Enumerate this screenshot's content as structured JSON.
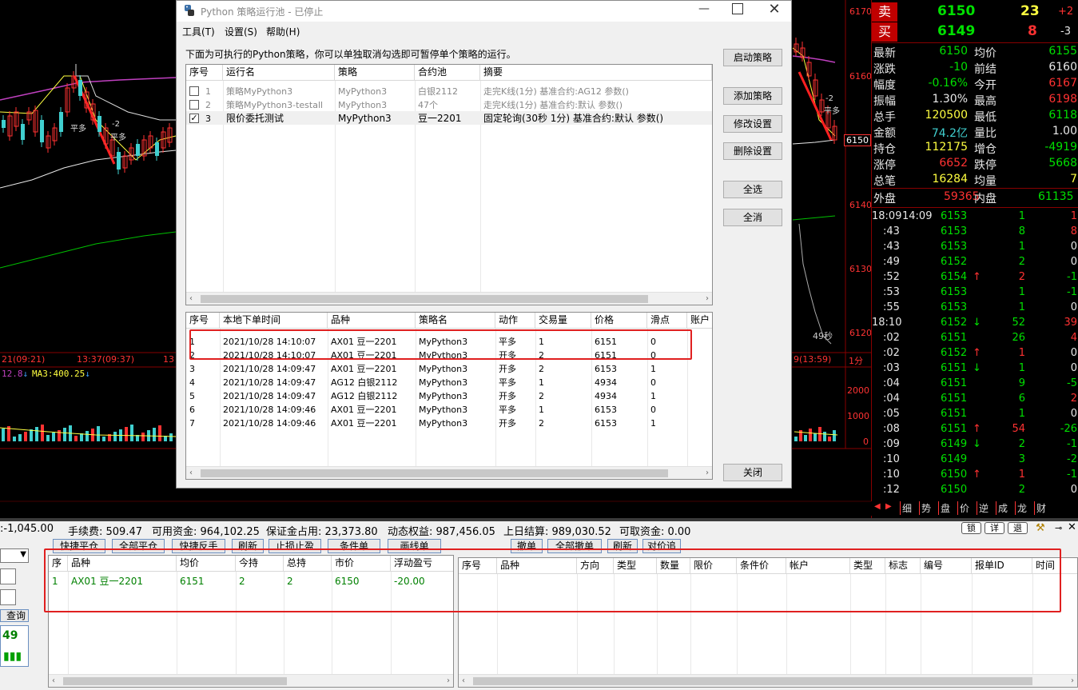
{
  "chart": {
    "price_labels": [
      "6170",
      "6160",
      "6150",
      "6140",
      "6130",
      "6120"
    ],
    "volume_labels": [
      "2000",
      "1000",
      "0"
    ],
    "time_labels": [
      "21(09:21)",
      "13:37(09:37)",
      "13",
      "9(13:59)"
    ],
    "period_label": "1分",
    "ma_line": "MA3:400.25",
    "ma_prefix": "12.8",
    "annotations": [
      "-2",
      "平多",
      "-2",
      "平多",
      "-2",
      "平多"
    ],
    "current_price_tag": "6150",
    "countdown": "49秒"
  },
  "quote": {
    "sell": {
      "label": "卖",
      "price": "6150",
      "vol": "23",
      "chg": "+2"
    },
    "buy": {
      "label": "买",
      "price": "6149",
      "vol": "8",
      "chg": "-3"
    },
    "rows": [
      {
        "l1": "最新",
        "v1": "6150",
        "l2": "均价",
        "v2": "6155"
      },
      {
        "l1": "涨跌",
        "v1": "-10",
        "l2": "前结",
        "v2": "6160"
      },
      {
        "l1": "幅度",
        "v1": "-0.16%",
        "l2": "今开",
        "v2": "6167"
      },
      {
        "l1": "振幅",
        "v1": "1.30%",
        "l2": "最高",
        "v2": "6198"
      },
      {
        "l1": "总手",
        "v1": "120500",
        "l2": "最低",
        "v2": "6118"
      },
      {
        "l1": "金额",
        "v1": "74.2亿",
        "l2": "量比",
        "v2": "1.00"
      },
      {
        "l1": "持仓",
        "v1": "112175",
        "l2": "增仓",
        "v2": "-4919"
      },
      {
        "l1": "涨停",
        "v1": "6652",
        "l2": "跌停",
        "v2": "5668"
      },
      {
        "l1": "总笔",
        "v1": "16284",
        "l2": "均量",
        "v2": "7"
      }
    ],
    "outer": {
      "l": "外盘",
      "v": "59365",
      "l2": "内盘",
      "v2": "61135"
    },
    "ticks": [
      {
        "t": "18:09",
        "t2": "14:09",
        "p": "6153",
        "a": "",
        "v": "1",
        "d": "1"
      },
      {
        "t": ":43",
        "p": "6153",
        "a": "",
        "v": "8",
        "d": "8"
      },
      {
        "t": ":43",
        "p": "6153",
        "a": "",
        "v": "1",
        "d": "0"
      },
      {
        "t": ":49",
        "p": "6152",
        "a": "",
        "v": "2",
        "d": "0"
      },
      {
        "t": ":52",
        "p": "6154",
        "a": "↑",
        "v": "2",
        "d": "-1"
      },
      {
        "t": ":53",
        "p": "6153",
        "a": "",
        "v": "1",
        "d": "-1"
      },
      {
        "t": ":55",
        "p": "6153",
        "a": "",
        "v": "1",
        "d": "0"
      },
      {
        "t": "18:10",
        "p": "6152",
        "a": "↓",
        "v": "52",
        "d": "39"
      },
      {
        "t": ":02",
        "p": "6151",
        "a": "",
        "v": "26",
        "d": "4"
      },
      {
        "t": ":02",
        "p": "6152",
        "a": "↑",
        "v": "1",
        "d": "0"
      },
      {
        "t": ":03",
        "p": "6151",
        "a": "↓",
        "v": "1",
        "d": "0"
      },
      {
        "t": ":04",
        "p": "6151",
        "a": "",
        "v": "9",
        "d": "-5"
      },
      {
        "t": ":04",
        "p": "6151",
        "a": "",
        "v": "6",
        "d": "2"
      },
      {
        "t": ":05",
        "p": "6151",
        "a": "",
        "v": "1",
        "d": "0"
      },
      {
        "t": ":08",
        "p": "6151",
        "a": "↑",
        "v": "54",
        "d": "-26"
      },
      {
        "t": ":09",
        "p": "6149",
        "a": "↓",
        "v": "2",
        "d": "-1"
      },
      {
        "t": ":10",
        "p": "6149",
        "a": "",
        "v": "3",
        "d": "-2"
      },
      {
        "t": ":10",
        "p": "6150",
        "a": "↑",
        "v": "1",
        "d": "-1"
      },
      {
        "t": ":12",
        "p": "6150",
        "a": "",
        "v": "2",
        "d": "0"
      }
    ],
    "tabs": [
      "细",
      "势",
      "盘",
      "价",
      "逆",
      "成",
      "龙",
      "财"
    ]
  },
  "dialog": {
    "title": "Python 策略运行池 - 已停止",
    "menu": [
      "工具(T)",
      "设置(S)",
      "帮助(H)"
    ],
    "description": "下面为可执行的Python策略，你可以单独取消勾选即可暂停单个策略的运行。",
    "buttons": {
      "start": "启动策略",
      "add": "添加策略",
      "edit": "修改设置",
      "delete": "删除设置",
      "select_all": "全选",
      "deselect_all": "全消",
      "close": "关闭"
    },
    "strategy_headers": [
      "序号",
      "运行名",
      "策略",
      "合约池",
      "摘要"
    ],
    "strategies": [
      {
        "no": "1",
        "name": "策略MyPython3",
        "strategy": "MyPython3",
        "pool": "白银2112",
        "summary": "走完K线(1分) 基准合约:AG12 参数()",
        "checked": false
      },
      {
        "no": "2",
        "name": "策略MyPython3-testall",
        "strategy": "MyPython3",
        "pool": "47个",
        "summary": "走完K线(1分) 基准合约:默认 参数()",
        "checked": false
      },
      {
        "no": "3",
        "name": "限价委托测试",
        "strategy": "MyPython3",
        "pool": "豆一2201",
        "summary": "固定轮询(30秒 1分) 基准合约:默认 参数()",
        "checked": true
      }
    ],
    "order_headers": [
      "序号",
      "本地下单时间",
      "品种",
      "策略名",
      "动作",
      "交易量",
      "价格",
      "滑点",
      "账户"
    ],
    "orders": [
      [
        "1",
        "2021/10/28 14:10:07",
        "AX01 豆一2201",
        "MyPython3",
        "平多",
        "1",
        "6151",
        "0"
      ],
      [
        "2",
        "2021/10/28 14:10:07",
        "AX01 豆一2201",
        "MyPython3",
        "开多",
        "2",
        "6151",
        "0"
      ],
      [
        "3",
        "2021/10/28 14:09:47",
        "AX01 豆一2201",
        "MyPython3",
        "开多",
        "2",
        "6153",
        "1"
      ],
      [
        "4",
        "2021/10/28 14:09:47",
        "AG12 白银2112",
        "MyPython3",
        "平多",
        "1",
        "4934",
        "0"
      ],
      [
        "5",
        "2021/10/28 14:09:47",
        "AG12 白银2112",
        "MyPython3",
        "开多",
        "2",
        "4934",
        "1"
      ],
      [
        "6",
        "2021/10/28 14:09:46",
        "AX01 豆一2201",
        "MyPython3",
        "平多",
        "1",
        "6153",
        "0"
      ],
      [
        "7",
        "2021/10/28 14:09:46",
        "AX01 豆一2201",
        "MyPython3",
        "开多",
        "2",
        "6153",
        "1"
      ]
    ]
  },
  "account": {
    "items": [
      ":-1,045.00",
      "手续费: 509.47",
      "可用资金: 964,102.25",
      "保证金占用: 23,373.80",
      "动态权益: 987,456.05",
      "上日结算: 989,030.52",
      "可取资金: 0.00"
    ],
    "right_buttons": [
      "锁",
      "详",
      "退"
    ],
    "toolbar_left": [
      "快捷平仓",
      "全部平仓",
      "快捷反手",
      "刷新",
      "止损止盈",
      "条件单",
      "画线单"
    ],
    "toolbar_right": [
      "撤单",
      "全部撤单",
      "刷新",
      "对价追"
    ],
    "pos_headers": [
      "序",
      "品种",
      "均价",
      "今持",
      "总持",
      "市价",
      "浮动盈亏"
    ],
    "positions": [
      [
        "1",
        "AX01 豆一2201",
        "6151",
        "2",
        "2",
        "6150",
        "-20.00"
      ]
    ],
    "ord_headers": [
      "序号",
      "品种",
      "方向",
      "类型",
      "数量",
      "限价",
      "条件价",
      "帐户",
      "类型",
      "标志",
      "编号",
      "报单ID",
      "时间"
    ],
    "side_query": "查询",
    "side_price": "49"
  }
}
